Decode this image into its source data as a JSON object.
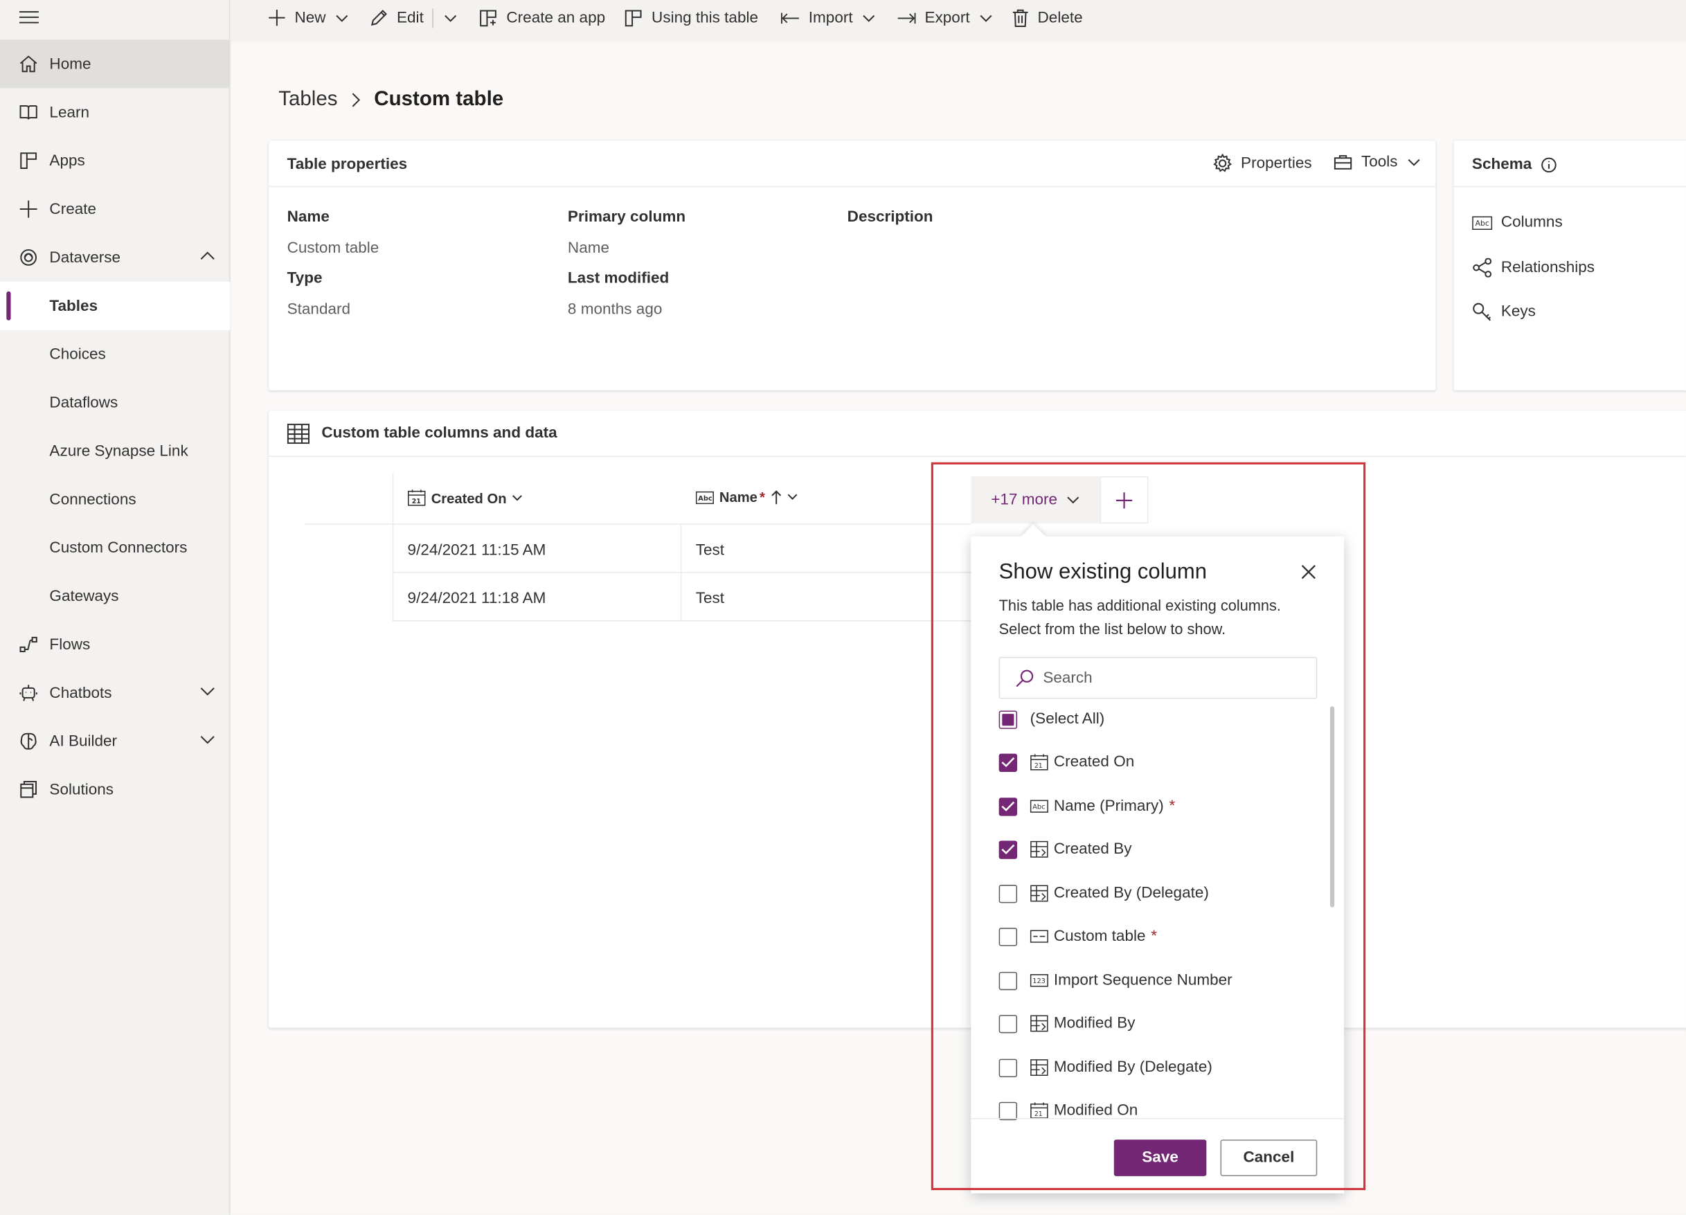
{
  "sidebar": {
    "items": [
      {
        "label": "Home"
      },
      {
        "label": "Learn"
      },
      {
        "label": "Apps"
      },
      {
        "label": "Create"
      },
      {
        "label": "Dataverse"
      },
      {
        "label": "Tables"
      },
      {
        "label": "Choices"
      },
      {
        "label": "Dataflows"
      },
      {
        "label": "Azure Synapse Link"
      },
      {
        "label": "Connections"
      },
      {
        "label": "Custom Connectors"
      },
      {
        "label": "Gateways"
      },
      {
        "label": "Flows"
      },
      {
        "label": "Chatbots"
      },
      {
        "label": "AI Builder"
      },
      {
        "label": "Solutions"
      }
    ]
  },
  "commandbar": {
    "new": "New",
    "edit": "Edit",
    "create_app": "Create an app",
    "using_table": "Using this table",
    "import": "Import",
    "export": "Export",
    "delete": "Delete"
  },
  "breadcrumb": {
    "parent": "Tables",
    "current": "Custom table"
  },
  "properties": {
    "title": "Table properties",
    "properties_btn": "Properties",
    "tools_btn": "Tools",
    "name_label": "Name",
    "name_value": "Custom table",
    "type_label": "Type",
    "type_value": "Standard",
    "primary_label": "Primary column",
    "primary_value": "Name",
    "modified_label": "Last modified",
    "modified_value": "8 months ago",
    "description_label": "Description"
  },
  "schema": {
    "title": "Schema",
    "items": [
      {
        "label": "Columns"
      },
      {
        "label": "Relationships"
      },
      {
        "label": "Keys"
      }
    ]
  },
  "data": {
    "title": "Custom table columns and data",
    "columns": [
      "Created On",
      "Name"
    ],
    "rows": [
      [
        "9/24/2021 11:15 AM",
        "Test"
      ],
      [
        "9/24/2021 11:18 AM",
        "Test"
      ]
    ],
    "more_label": "+17 more"
  },
  "flyout": {
    "title": "Show existing column",
    "description": "This table has additional existing columns. Select from the list below to show.",
    "search_placeholder": "Search",
    "options": [
      {
        "label": "(Select All)",
        "state": "indeterminate",
        "icon": "",
        "required": false
      },
      {
        "label": "Created On",
        "state": "checked",
        "icon": "calendar-icon",
        "required": false
      },
      {
        "label": "Name (Primary)",
        "state": "checked",
        "icon": "text-icon",
        "required": true
      },
      {
        "label": "Created By",
        "state": "checked",
        "icon": "lookup-icon",
        "required": false
      },
      {
        "label": "Created By (Delegate)",
        "state": "unchecked",
        "icon": "lookup-icon",
        "required": false
      },
      {
        "label": "Custom table",
        "state": "unchecked",
        "icon": "uid-icon",
        "required": true
      },
      {
        "label": "Import Sequence Number",
        "state": "unchecked",
        "icon": "number-icon",
        "required": false
      },
      {
        "label": "Modified By",
        "state": "unchecked",
        "icon": "lookup-icon",
        "required": false
      },
      {
        "label": "Modified By (Delegate)",
        "state": "unchecked",
        "icon": "lookup-icon",
        "required": false
      },
      {
        "label": "Modified On",
        "state": "unchecked",
        "icon": "calendar-icon",
        "required": false
      }
    ],
    "save": "Save",
    "cancel": "Cancel"
  },
  "colors": {
    "accent": "#742774",
    "highlight": "#d13438",
    "required": "#a4262c"
  }
}
